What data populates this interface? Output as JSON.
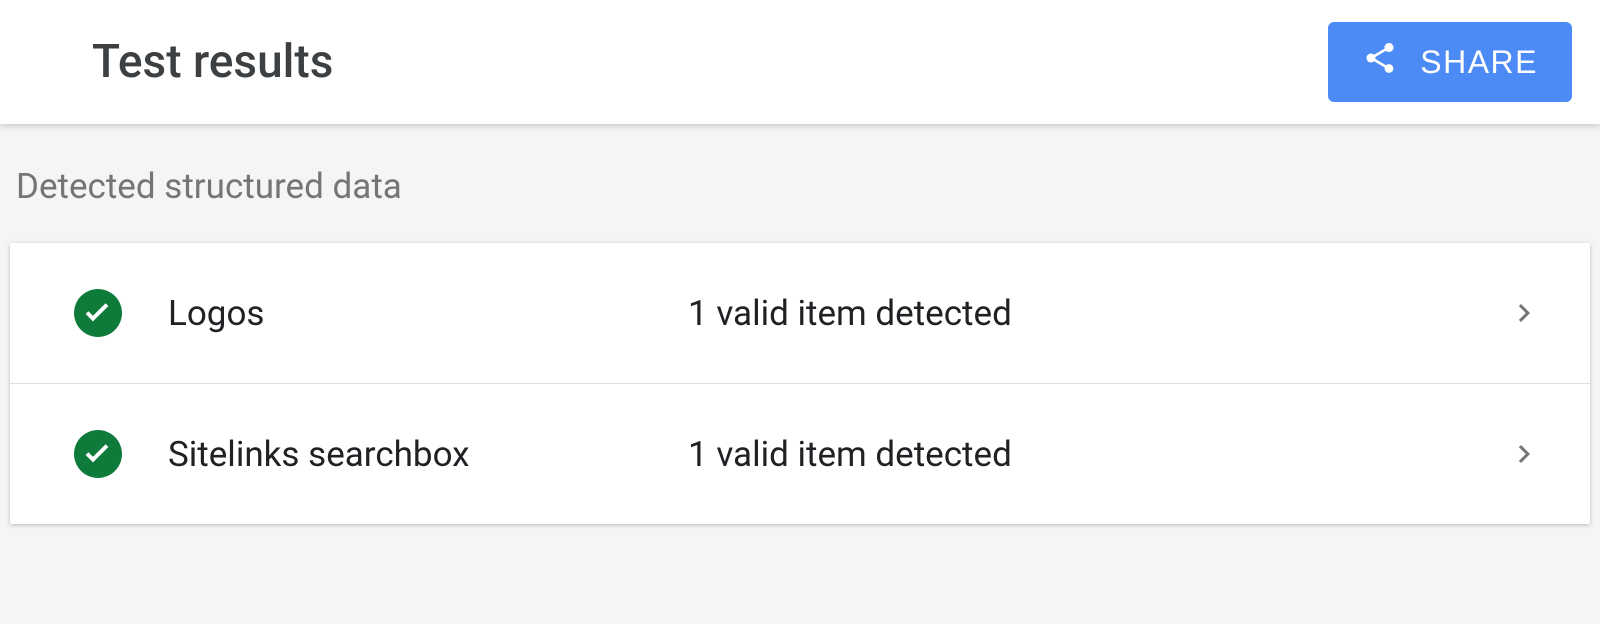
{
  "header": {
    "title": "Test results",
    "share_label": "SHARE"
  },
  "section": {
    "label": "Detected structured data"
  },
  "rows": [
    {
      "name": "Logos",
      "status": "1 valid item detected"
    },
    {
      "name": "Sitelinks searchbox",
      "status": "1 valid item detected"
    }
  ],
  "colors": {
    "success": "#0f7b3b",
    "accent": "#4c8bf5"
  }
}
